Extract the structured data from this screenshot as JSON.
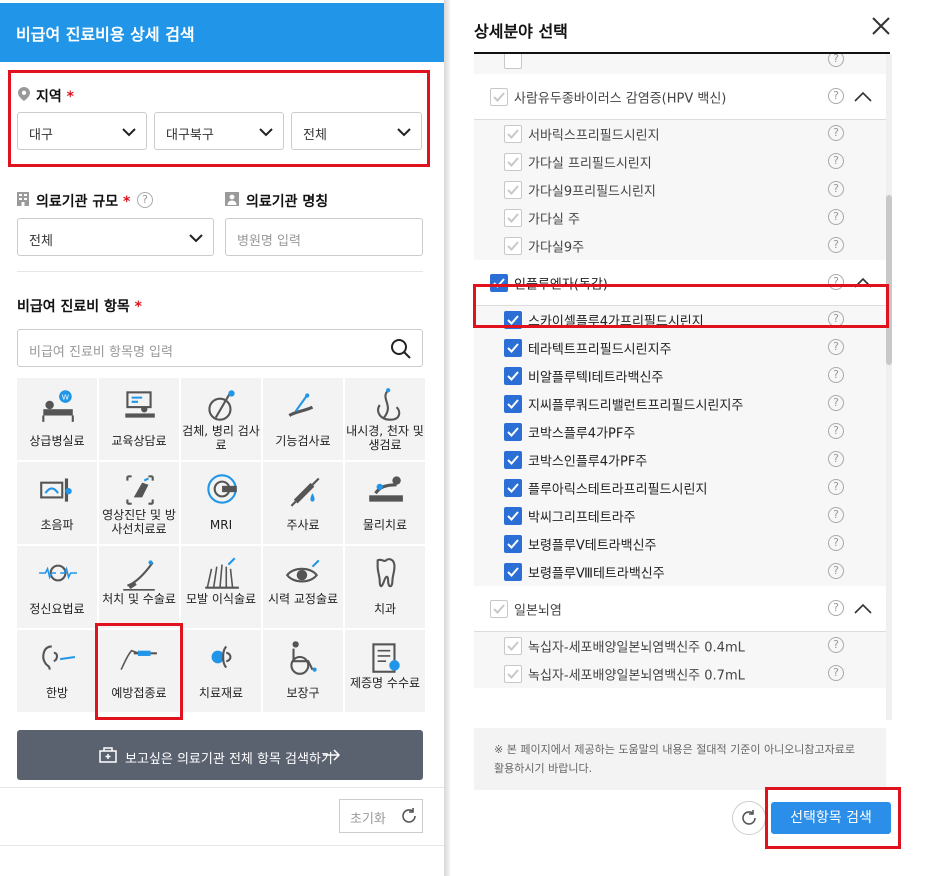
{
  "left": {
    "header_title": "비급여 진료비용 상세 검색",
    "region": {
      "label": "지역",
      "required_mark": "*",
      "selects": [
        "대구",
        "대구북구",
        "전체"
      ]
    },
    "scale": {
      "label": "의료기관 규모",
      "required_mark": "*",
      "help": "?",
      "value": "전체"
    },
    "name_field": {
      "label": "의료기관 명칭",
      "placeholder": "병원명 입력"
    },
    "items": {
      "label": "비급여 진료비 항목",
      "required_mark": "*",
      "search_placeholder": "비급여 진료비 항목명 입력"
    },
    "categories": [
      {
        "label": "상급병실료",
        "icon": "hospital-bed-icon"
      },
      {
        "label": "교육상담료",
        "icon": "consultation-icon"
      },
      {
        "label": "검체, 병리 검사료",
        "icon": "pathology-test-icon"
      },
      {
        "label": "기능검사료",
        "icon": "function-test-icon"
      },
      {
        "label": "내시경, 천자 및 생검료",
        "icon": "endoscope-icon"
      },
      {
        "label": "초음파",
        "icon": "ultrasound-icon"
      },
      {
        "label": "영상진단 및 방사선치료료",
        "icon": "radiology-icon"
      },
      {
        "label": "MRI",
        "icon": "mri-icon"
      },
      {
        "label": "주사료",
        "icon": "injection-icon"
      },
      {
        "label": "물리치료",
        "icon": "physical-therapy-icon"
      },
      {
        "label": "정신요법료",
        "icon": "brain-wave-icon"
      },
      {
        "label": "처치 및 수술료",
        "icon": "surgery-icon"
      },
      {
        "label": "모발 이식술료",
        "icon": "hair-transplant-icon"
      },
      {
        "label": "시력 교정술료",
        "icon": "eye-icon"
      },
      {
        "label": "치과",
        "icon": "tooth-icon"
      },
      {
        "label": "한방",
        "icon": "acupuncture-icon"
      },
      {
        "label": "예방접종료",
        "icon": "vaccination-icon"
      },
      {
        "label": "치료재료",
        "icon": "treatment-material-icon"
      },
      {
        "label": "보장구",
        "icon": "wheelchair-icon"
      },
      {
        "label": "제증명 수수료",
        "icon": "certificate-icon"
      }
    ],
    "wide_button": "보고싶은 의료기관 전체 항목 검색하기",
    "reset_button": "초기화"
  },
  "right": {
    "title": "상세분야 선택",
    "list": [
      {
        "type": "sub",
        "name": "",
        "checked": false
      },
      {
        "type": "hdr",
        "name": "사람유두종바이러스 감염증(HPV 백신)",
        "checked": true,
        "muted": true
      },
      {
        "type": "sub",
        "name": "서바릭스프리필드시린지",
        "checked": true,
        "muted": true
      },
      {
        "type": "sub",
        "name": "가다실 프리필드시린지",
        "checked": true,
        "muted": true
      },
      {
        "type": "sub",
        "name": "가다실9프리필드시린지",
        "checked": true,
        "muted": true
      },
      {
        "type": "sub",
        "name": "가다실 주",
        "checked": true,
        "muted": true
      },
      {
        "type": "sub",
        "name": "가다실9주",
        "checked": true,
        "muted": true
      },
      {
        "type": "hdr",
        "name": "인플루엔자(독감)",
        "checked": true,
        "muted": false
      },
      {
        "type": "sub",
        "name": "스카이셀플루4가프리필드시린지",
        "checked": true,
        "muted": false
      },
      {
        "type": "sub",
        "name": "테라텍트프리필드시린지주",
        "checked": true,
        "muted": false
      },
      {
        "type": "sub",
        "name": "비알플루텍I테트라백신주",
        "checked": true,
        "muted": false
      },
      {
        "type": "sub",
        "name": "지씨플루쿼드리밸런트프리필드시린지주",
        "checked": true,
        "muted": false
      },
      {
        "type": "sub",
        "name": "코박스플루4가PF주",
        "checked": true,
        "muted": false
      },
      {
        "type": "sub",
        "name": "코박스인플루4가PF주",
        "checked": true,
        "muted": false
      },
      {
        "type": "sub",
        "name": "플루아릭스테트라프리필드시린지",
        "checked": true,
        "muted": false
      },
      {
        "type": "sub",
        "name": "박씨그리프테트라주",
        "checked": true,
        "muted": false
      },
      {
        "type": "sub",
        "name": "보령플루Ⅴ테트라백신주",
        "checked": true,
        "muted": false
      },
      {
        "type": "sub",
        "name": "보령플루Ⅷ테트라백신주",
        "checked": true,
        "muted": false
      },
      {
        "type": "hdr",
        "name": "일본뇌염",
        "checked": true,
        "muted": true
      },
      {
        "type": "sub",
        "name": "녹십자-세포배양일본뇌염백신주 0.4mL",
        "checked": true,
        "muted": true
      },
      {
        "type": "sub",
        "name": "녹십자-세포배양일본뇌염백신주 0.7mL",
        "checked": true,
        "muted": true
      }
    ],
    "notice": "※ 본 페이지에서 제공하는 도움말의 내용은 절대적 기준이 아니오니참고자료로 활용하시기 바랍니다.",
    "submit_button": "선택항목 검색"
  },
  "colors": {
    "accent": "#2196e8",
    "highlight": "#e0121e",
    "checkbox_on": "#2b6fd6",
    "dark_button": "#5a6270"
  }
}
